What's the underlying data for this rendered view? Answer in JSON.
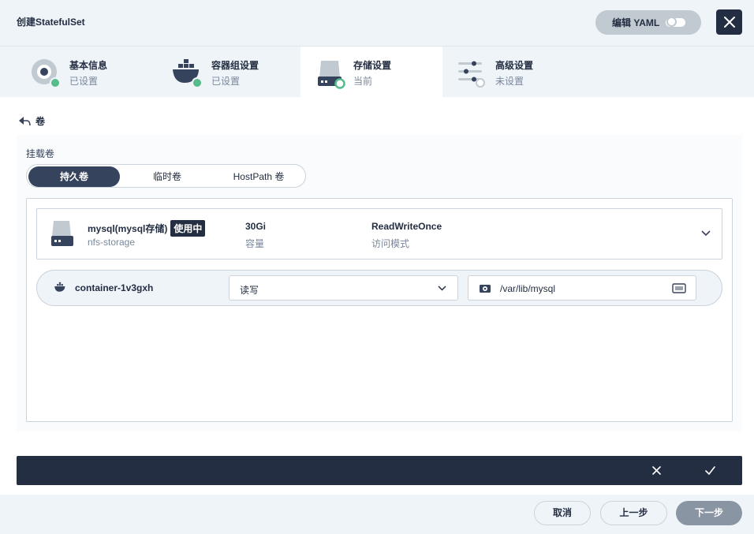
{
  "header": {
    "title": "创建StatefulSet",
    "yaml_label": "编辑 YAML"
  },
  "steps": [
    {
      "label": "基本信息",
      "status": "已设置"
    },
    {
      "label": "容器组设置",
      "status": "已设置"
    },
    {
      "label": "存储设置",
      "status": "当前"
    },
    {
      "label": "高级设置",
      "status": "未设置"
    }
  ],
  "section": {
    "back_label": "卷",
    "mount_label": "挂载卷",
    "tabs": [
      "持久卷",
      "临时卷",
      "HostPath 卷"
    ],
    "active_tab": "持久卷"
  },
  "volume": {
    "name": "mysql(mysql存储)",
    "badge": "使用中",
    "storage_class": "nfs-storage",
    "capacity": "30Gi",
    "capacity_label": "容量",
    "access_mode": "ReadWriteOnce",
    "access_mode_label": "访问模式"
  },
  "mount": {
    "container": "container-1v3gxh",
    "mode": "读写",
    "path": "/var/lib/mysql"
  },
  "footer": {
    "cancel": "取消",
    "prev": "上一步",
    "next": "下一步"
  },
  "colors": {
    "primary_dark": "#242e42",
    "success_green": "#55bc8a",
    "background": "#eff4f9"
  }
}
